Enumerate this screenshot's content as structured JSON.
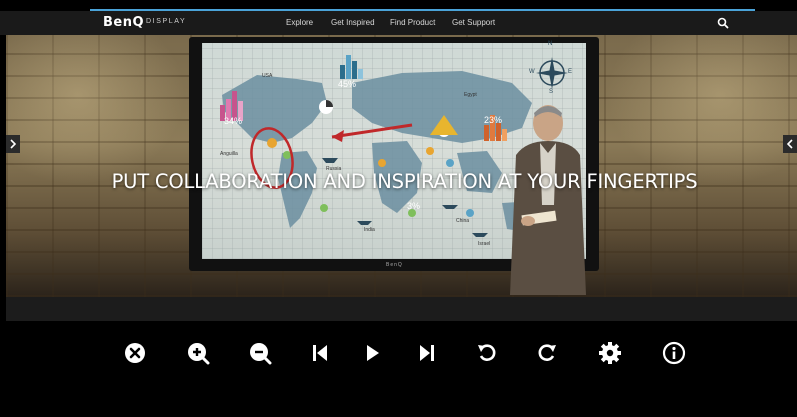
{
  "brand": {
    "logo": "BenQ",
    "sub": "DISPLAY",
    "accent": "#4aa3d8"
  },
  "nav": {
    "links": [
      "Explore",
      "Get Inspired",
      "Find Product",
      "Get Support"
    ],
    "search_icon": "search-icon"
  },
  "hero": {
    "headline": "PUT COLLABORATION AND INSPIRATION AT YOUR FINGERTIPS",
    "prev_icon": "chevron-right-icon",
    "next_icon": "chevron-left-icon",
    "screen_brand": "BenQ",
    "map_labels": {
      "usa": "USA",
      "pct_45": "45%",
      "pct_34": "34%",
      "anguilla": "Anguilla",
      "russia": "Russia",
      "egypt": "Egypt",
      "pct_23": "23%",
      "pct_3": "3%",
      "india": "India",
      "china": "China",
      "israel": "Israel",
      "compass_n": "N",
      "compass_s": "S",
      "compass_e": "E",
      "compass_w": "W"
    }
  },
  "toolbar": {
    "icons": [
      "close-icon",
      "zoom-in-icon",
      "zoom-out-icon",
      "previous-icon",
      "play-icon",
      "next-icon",
      "rotate-left-icon",
      "rotate-right-icon",
      "settings-icon",
      "info-icon"
    ]
  }
}
